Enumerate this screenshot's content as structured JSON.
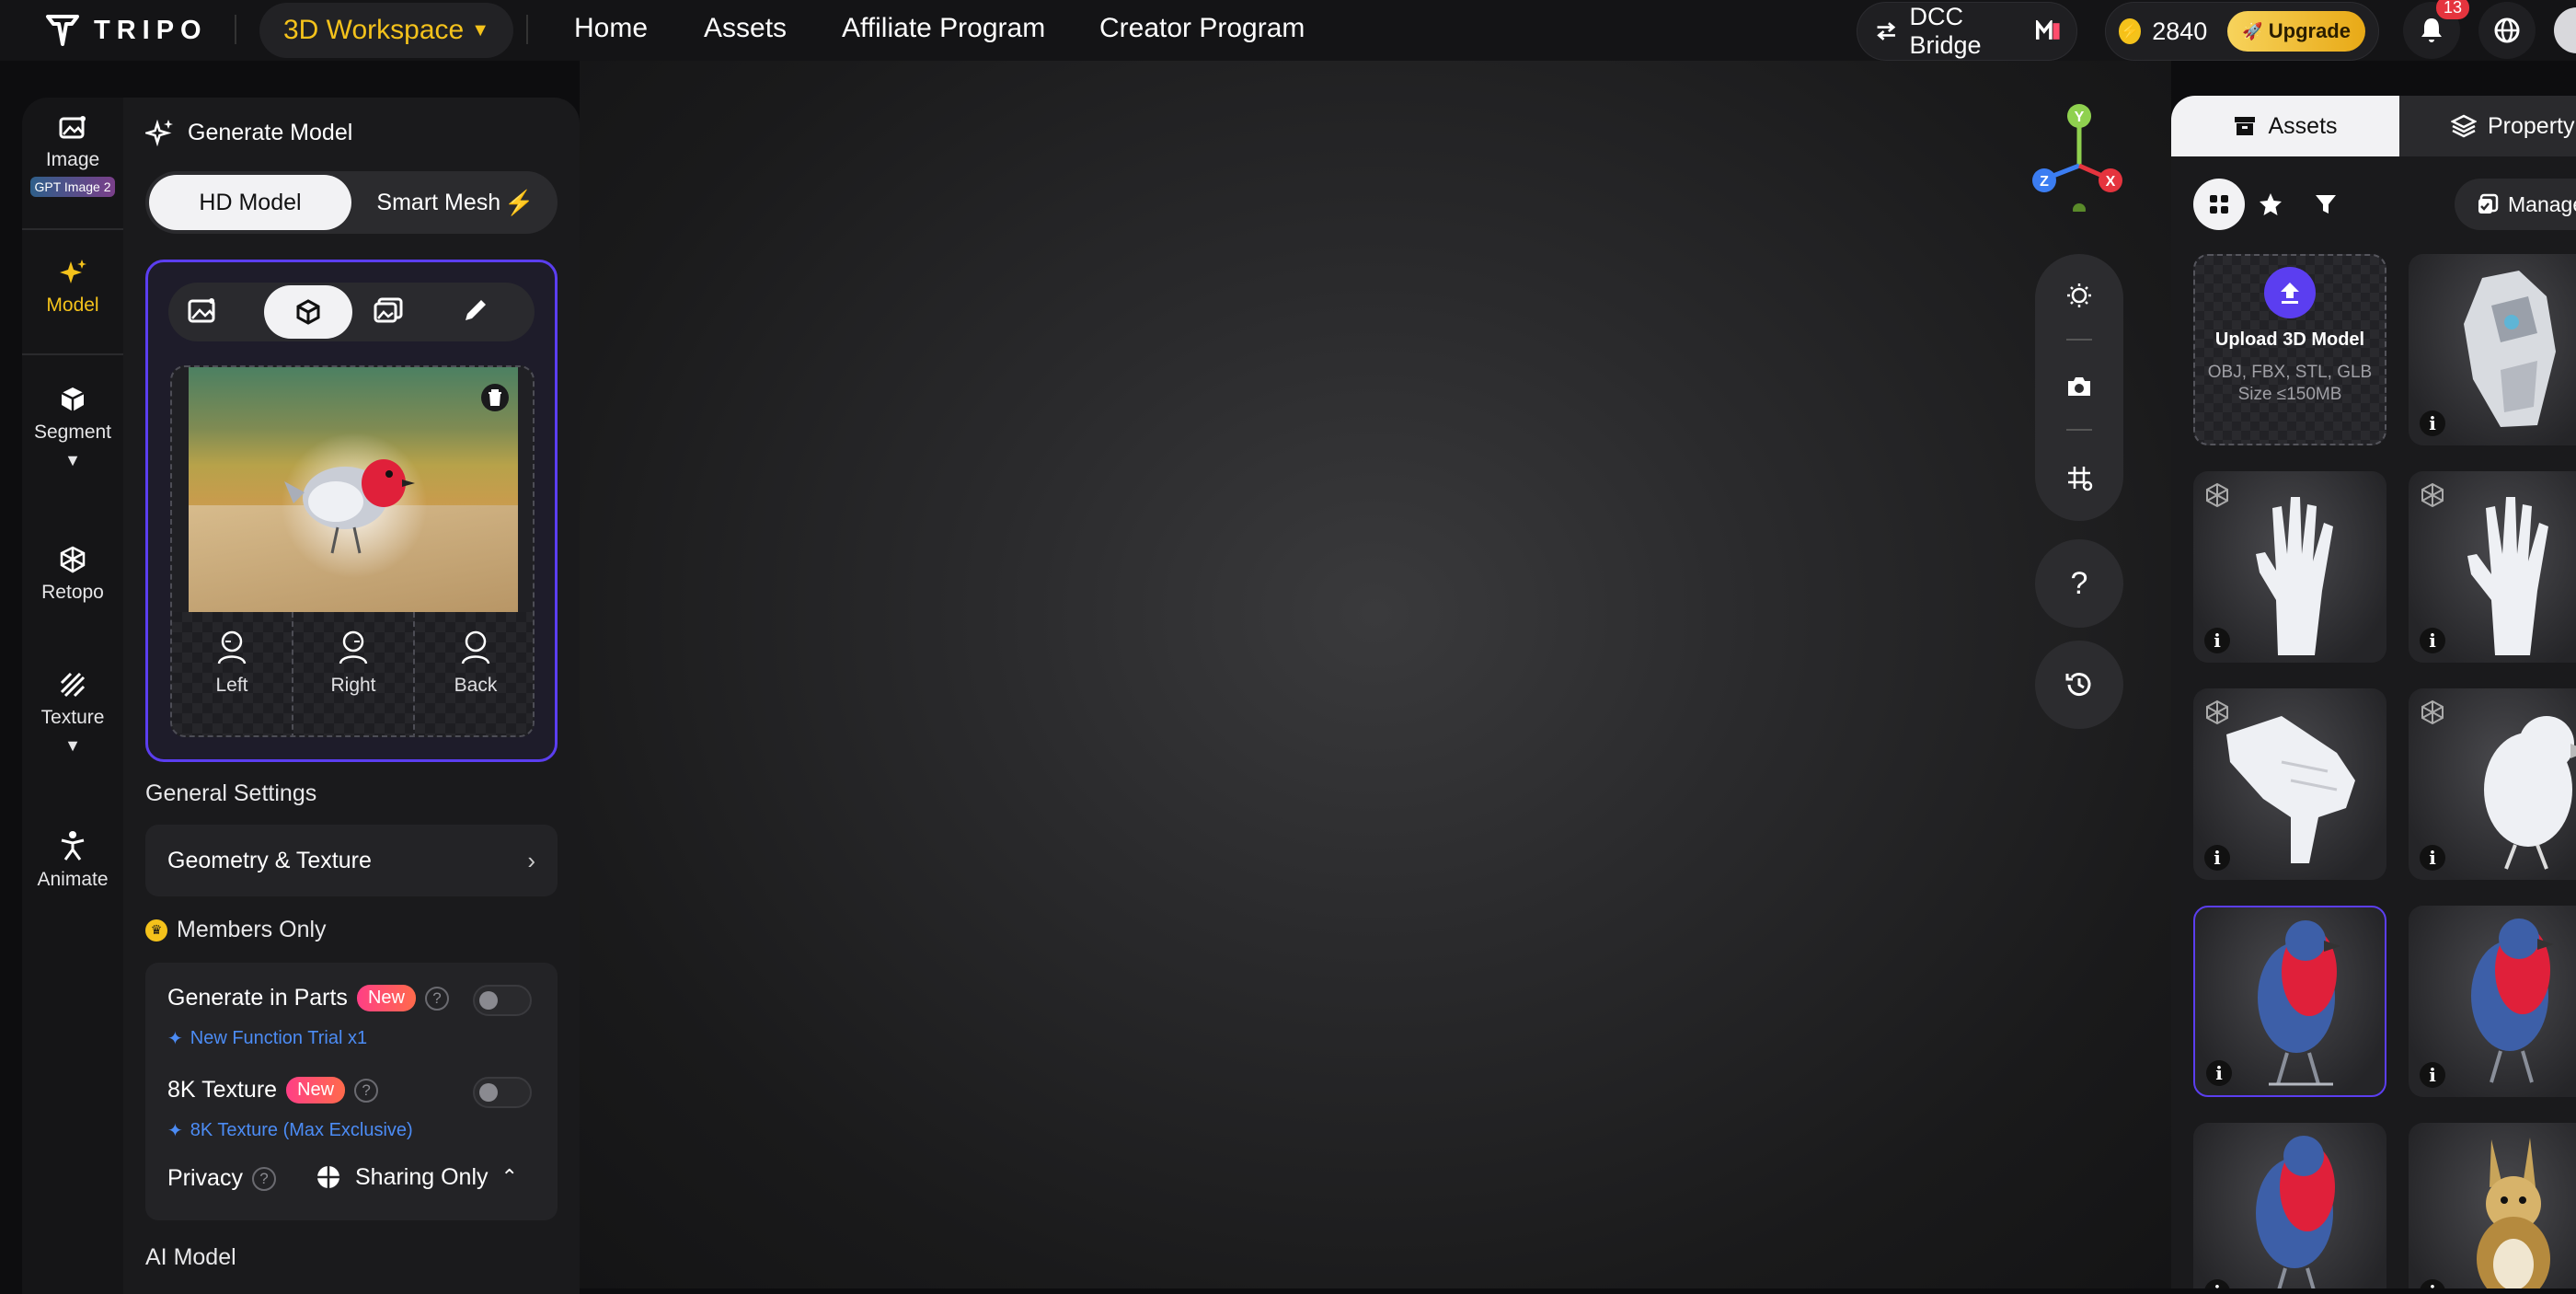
{
  "topbar": {
    "logo": "TRIPO",
    "workspace": "3D Workspace",
    "nav": [
      "Home",
      "Assets",
      "Affiliate Program",
      "Creator Program"
    ],
    "dcc_bridge": "DCC Bridge",
    "credits": "2840",
    "upgrade": "Upgrade",
    "notifications": "13"
  },
  "rail": {
    "image": "Image",
    "image_badge": "GPT Image 2",
    "model": "Model",
    "segment": "Segment",
    "retopo": "Retopo",
    "texture": "Texture",
    "animate": "Animate"
  },
  "panel": {
    "title": "Generate Model",
    "tabs": [
      "HD Model",
      "Smart Mesh"
    ],
    "views": [
      "Left",
      "Right",
      "Back"
    ],
    "general_settings": "General Settings",
    "geometry": "Geometry & Texture",
    "members_only": "Members Only",
    "gen_parts": "Generate in Parts",
    "gen_parts_sub": "New Function Trial x1",
    "texture8k": "8K Texture",
    "texture8k_sub": "8K Texture (Max Exclusive)",
    "new_badge": "New",
    "privacy": "Privacy",
    "sharing": "Sharing Only",
    "ai_model": "AI Model"
  },
  "gizmo": {
    "y": "Y",
    "z": "Z",
    "x": "X"
  },
  "viewport_help": "?",
  "right": {
    "tab_assets": "Assets",
    "tab_property": "Property",
    "manage": "Manage",
    "upload_title": "Upload 3D Model",
    "upload_formats": "OBJ, FBX, STL, GLB",
    "upload_size": "Size ≤150MB",
    "info": "i"
  },
  "colors": {
    "accent_yellow": "#f4c21b",
    "accent_purple": "#5b3ef0",
    "notification_red": "#e5343e"
  }
}
